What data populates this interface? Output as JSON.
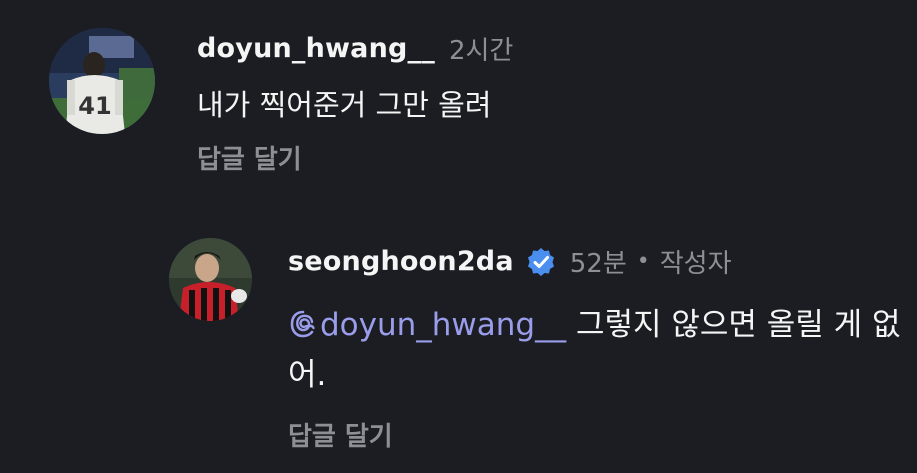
{
  "comments": [
    {
      "username": "doyun_hwang__",
      "time": "2시간",
      "text": "내가 찍어준거 그만 올려",
      "reply_label": "답글 달기",
      "avatar_jersey_number": "41"
    },
    {
      "username": "seonghoon2da",
      "verified": true,
      "time": "52분",
      "separator": "•",
      "author_tag": "작성자",
      "mention": "doyun_hwang__",
      "text": " 그렇지 않으면 올릴 게 없어.",
      "reply_label": "답글 달기"
    }
  ],
  "colors": {
    "background": "#1b1d22",
    "text": "#f5f5f5",
    "muted": "#8e8f94",
    "mention": "#9a9dea",
    "verified": "#4a8ef0"
  },
  "icons": {
    "verified": "verified-badge-icon",
    "mention": "threads-at-icon"
  }
}
